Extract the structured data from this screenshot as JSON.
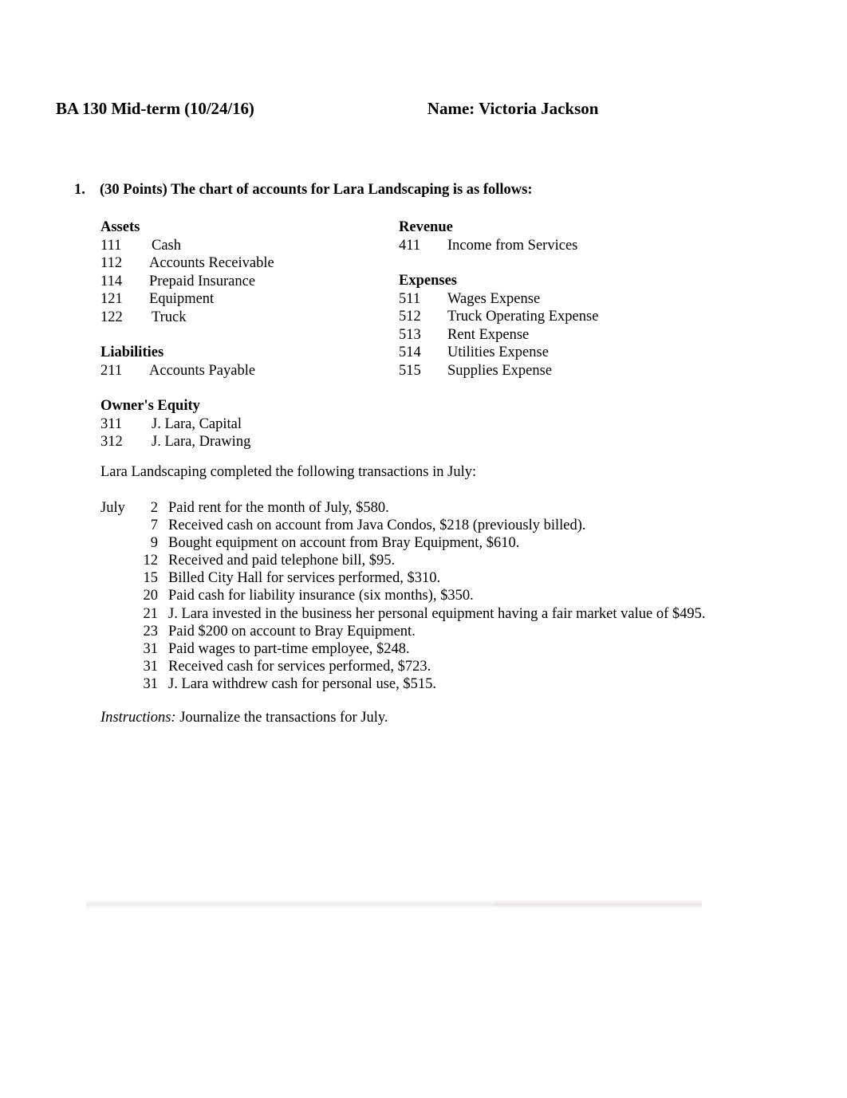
{
  "header": {
    "title": "BA 130 Mid-term (10/24/16)",
    "name": "Name: Victoria Jackson"
  },
  "question": {
    "number": "1.",
    "text": "(30 Points) The chart of accounts for Lara Landscaping is as follows:"
  },
  "chart_of_accounts": {
    "left_column": [
      {
        "heading": "Assets",
        "rows": [
          {
            "code": "111",
            "label": "Cash"
          },
          {
            "code": "112",
            "label": "Accounts Receivable"
          },
          {
            "code": "114",
            "label": "Prepaid Insurance"
          },
          {
            "code": "121",
            "label": "Equipment"
          },
          {
            "code": "122",
            "label": "Truck"
          }
        ]
      },
      {
        "heading": "Liabilities",
        "rows": [
          {
            "code": "211",
            "label": "Accounts Payable"
          }
        ]
      },
      {
        "heading": "Owner's Equity",
        "rows": [
          {
            "code": "311",
            "label": "J. Lara, Capital"
          },
          {
            "code": "312",
            "label": "J. Lara, Drawing"
          }
        ]
      }
    ],
    "right_column": [
      {
        "heading": "Revenue",
        "rows": [
          {
            "code": "411",
            "label": "Income from Services"
          }
        ]
      },
      {
        "heading": "Expenses",
        "rows": [
          {
            "code": "511",
            "label": "Wages Expense"
          },
          {
            "code": "512",
            "label": "Truck Operating Expense"
          },
          {
            "code": "513",
            "label": "Rent Expense"
          },
          {
            "code": "514",
            "label": "Utilities Expense"
          },
          {
            "code": "515",
            "label": "Supplies Expense"
          }
        ]
      }
    ]
  },
  "intro_line": "Lara Landscaping completed the following transactions in July:",
  "transactions": {
    "month": "July",
    "rows": [
      {
        "day": "2",
        "description": "Paid rent for the month of July, $580."
      },
      {
        "day": "7",
        "description": "Received cash on account from Java Condos, $218 (previously billed)."
      },
      {
        "day": "9",
        "description": "Bought equipment on account from Bray Equipment, $610."
      },
      {
        "day": "12",
        "description": "Received and paid telephone bill, $95."
      },
      {
        "day": "15",
        "description": "Billed City Hall for services performed, $310."
      },
      {
        "day": "20",
        "description": "Paid cash for liability insurance (six months), $350."
      },
      {
        "day": "21",
        "description": "J. Lara invested in the business her personal equipment having a fair market value of $495."
      },
      {
        "day": "23",
        "description": "Paid $200 on account to Bray Equipment."
      },
      {
        "day": "31",
        "description": "Paid wages to part-time employee, $248."
      },
      {
        "day": "31",
        "description": "Received cash for services performed, $723."
      },
      {
        "day": "31",
        "description": "J. Lara withdrew cash for personal use, $515."
      }
    ]
  },
  "instructions": {
    "label": "Instructions:",
    "text": "Journalize the transactions for July."
  }
}
